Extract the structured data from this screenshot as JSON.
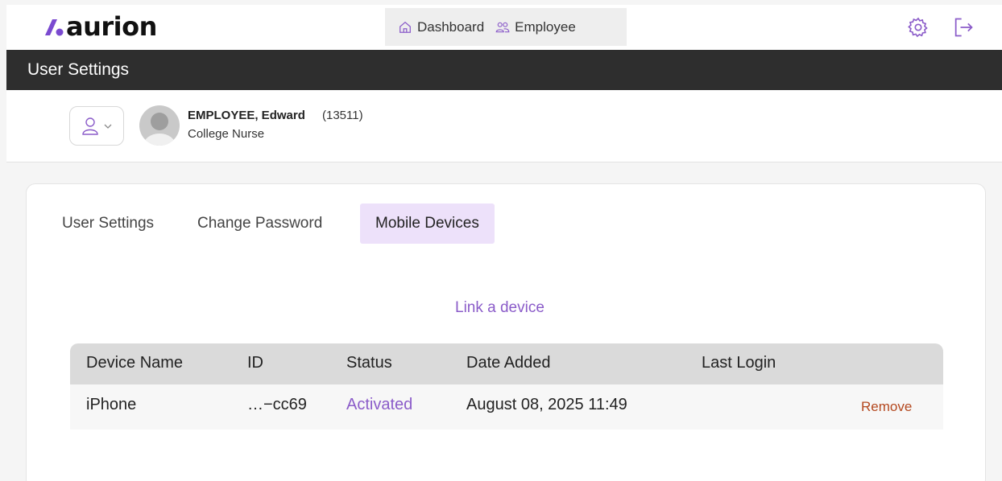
{
  "app": {
    "logo_text": "aurion",
    "nav": [
      {
        "label": "Dashboard",
        "icon": "home-icon"
      },
      {
        "label": "Employee",
        "icon": "users-icon"
      }
    ],
    "settings_icon": "gear-icon",
    "logout_icon": "logout-icon"
  },
  "page": {
    "title": "User Settings"
  },
  "user": {
    "name": "EMPLOYEE, Edward",
    "id": "(13511)",
    "role": "College Nurse"
  },
  "tabs": [
    {
      "label": "User Settings",
      "active": false
    },
    {
      "label": "Change Password",
      "active": false
    },
    {
      "label": "Mobile Devices",
      "active": true
    }
  ],
  "devices": {
    "link_label": "Link a device",
    "columns": [
      "Device Name",
      "ID",
      "Status",
      "Date Added",
      "Last Login"
    ],
    "rows": [
      {
        "device_name": "iPhone",
        "id": "…−cc69",
        "status": "Activated",
        "date_added": "August 08, 2025 11:49",
        "last_login": "",
        "action": "Remove"
      }
    ]
  },
  "colors": {
    "accent": "#8b5cc9",
    "active_tab_bg": "#ede1fa",
    "title_bar": "#2e2e2e",
    "remove": "#b4481f"
  }
}
